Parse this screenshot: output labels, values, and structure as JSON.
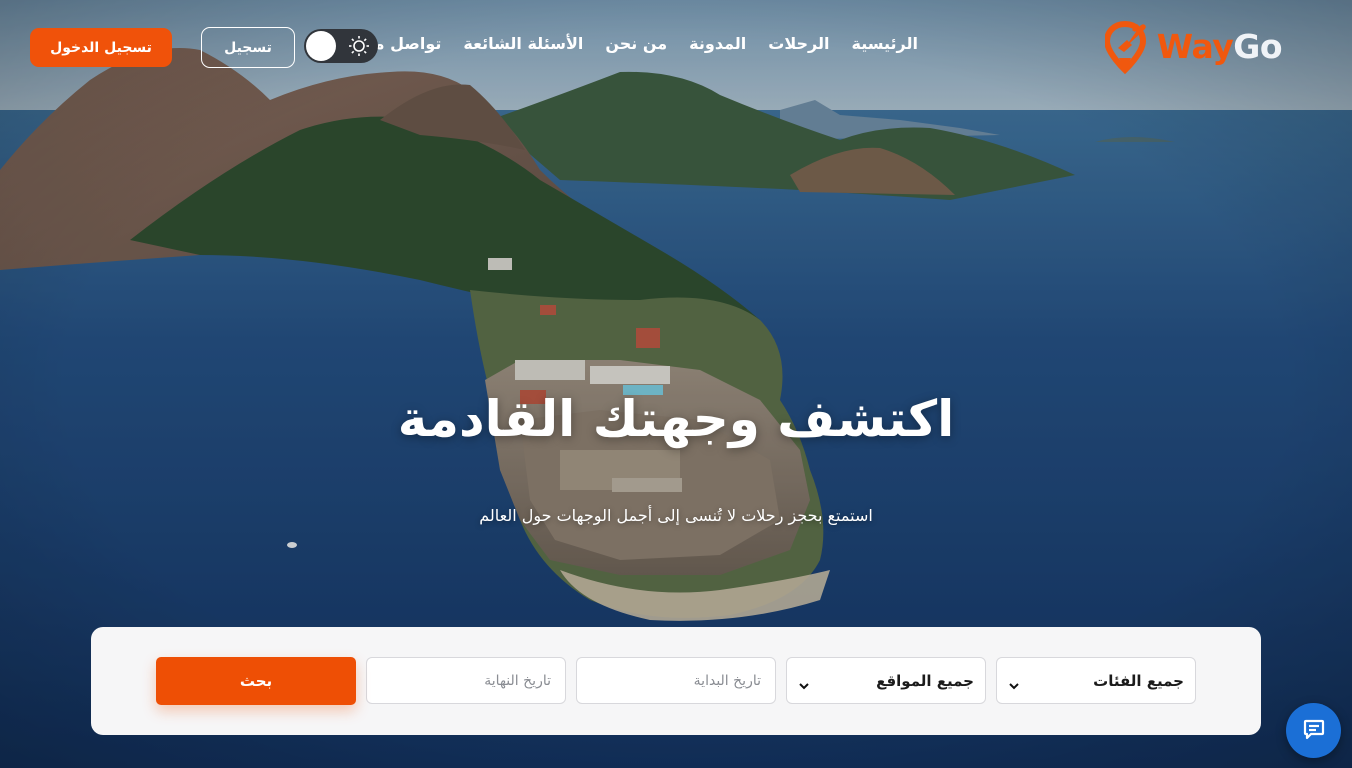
{
  "brand": {
    "name_part1": "Way",
    "name_part2": "Go",
    "primary_color": "#f0520a",
    "logo_icon": "map-pin-airplane-icon"
  },
  "nav": {
    "links": [
      {
        "label": "الرئيسية"
      },
      {
        "label": "الرحلات"
      },
      {
        "label": "المدونة"
      },
      {
        "label": "من نحن"
      },
      {
        "label": "الأسئلة الشائعة"
      },
      {
        "label": "تواصل معنا"
      }
    ],
    "theme_toggle_icon": "sun-icon",
    "signup_label": "تسجيل",
    "login_label": "تسجيل الدخول"
  },
  "hero": {
    "title": "اكتشف وجهتك القادمة",
    "subtitle": "استمتع بحجز رحلات لا تُنسى إلى أجمل الوجهات حول العالم"
  },
  "search": {
    "category_select": "جميع الفئات",
    "location_select": "جميع المواقع",
    "start_date_placeholder": "تاريخ البداية",
    "end_date_placeholder": "تاريخ النهاية",
    "search_button": "بحث"
  },
  "chat": {
    "icon": "chat-bubble-icon",
    "color": "#1b6fd6"
  }
}
